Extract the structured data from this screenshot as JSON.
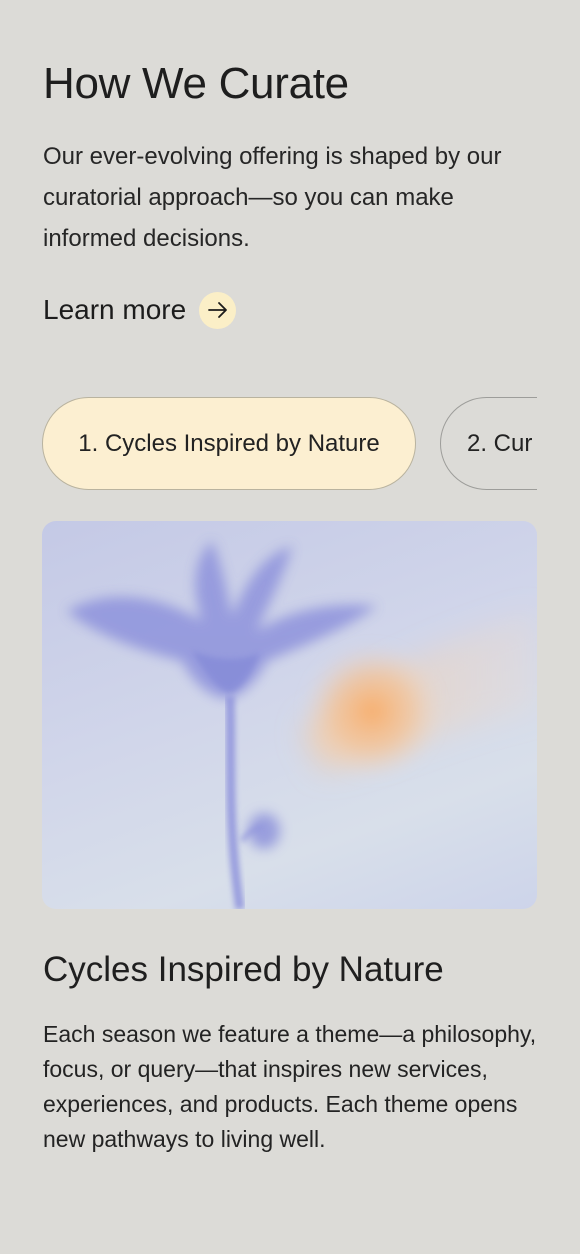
{
  "section": {
    "title": "How We Curate",
    "intro": "Our ever-evolving offering is shaped by our curatorial approach—so you can make informed decisions.",
    "learn_more": {
      "label": "Learn more",
      "icon": "arrow-right-icon",
      "accent": "#fbefc7"
    }
  },
  "tabs": [
    {
      "label": "1. Cycles Inspired by Nature",
      "active": true
    },
    {
      "label": "2. Cur",
      "active": false
    }
  ],
  "hero_image": {
    "description_name": "flower-silhouette-image",
    "colors": {
      "flower": "#8f93d9",
      "glow": "#f5b27a",
      "background": "#d1d6ea"
    }
  },
  "feature": {
    "title": "Cycles Inspired by Nature",
    "body": "Each season we feature a theme—a philosophy, focus, or query—that inspires new services, experiences, and products. Each theme opens new pathways to living well."
  },
  "colors": {
    "page_background": "#dcdbd7",
    "active_tab": "#fcefd1"
  }
}
